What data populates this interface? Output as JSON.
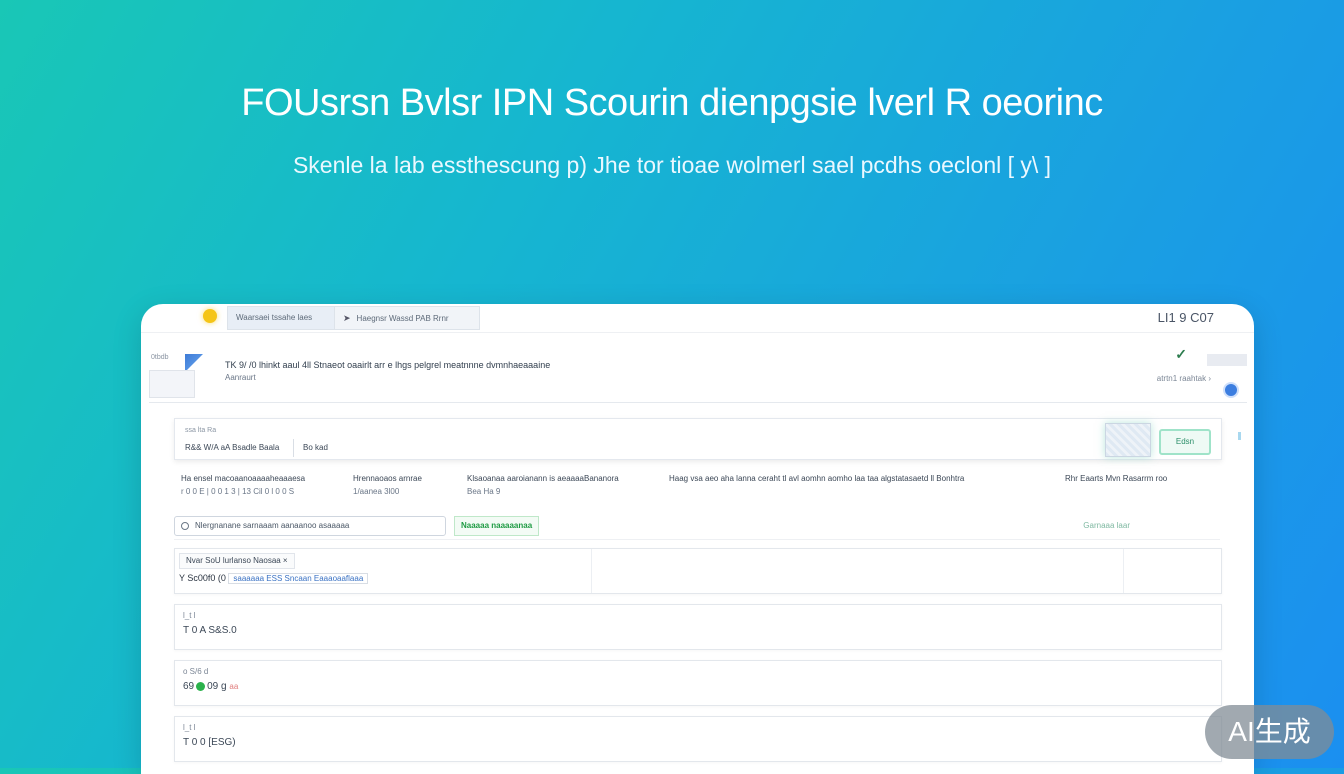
{
  "hero": {
    "title": "FOUsrsn Bvlsr IPN Scourin dienpgsie lverl R oeorinc",
    "subtitle": "Skenle la lab essthescung p) Jhe tor tioae wolmerl sael pcdhs oeclonl [ y\\ ]"
  },
  "window": {
    "tabs": [
      "Waarsaei tssahe laes",
      "Haegnsr Wassd PAB Rrnr"
    ],
    "clock": "LI1 9 C07",
    "header": {
      "line1": "TK 9/ /0 lhinkt aaul 4ll Stnaeot oaairlt arr e lhgs pelgrel meatnnne dvmnhaeaaaine",
      "line2": "Aanraurt",
      "logo_caption": "0tbdb",
      "right_text": "atrtn1 raahtak ›"
    },
    "filter": {
      "label": "ssa   lta   Ra",
      "value": "R&& W/A aA Bsadle Baala",
      "extra": "Bo kad",
      "button": "Edsn"
    },
    "info_columns": [
      {
        "top": "Ha ensel macoaanoaaaaheaaaesa",
        "bottom": "r 0 0 E | 0 0 1 3 | 13 Cil 0 l 0 0 S"
      },
      {
        "top": "Hrennaoaos arnrae",
        "bottom": "1/aanea 3l00"
      },
      {
        "top": "Klsaoanaa aaroianann is aeaaaaBananora",
        "bottom": "Bea Ha 9"
      },
      {
        "top": "Haag vsa aeo aha lanna ceraht tl avl aomhn aomho laa taa algstatasaetd ll Bonhtra",
        "bottom": ""
      },
      {
        "top": "Rhr Eaarts Mvn Rasarrm roo",
        "bottom": ""
      }
    ],
    "action_bar": {
      "search_text": "Nlergnanane   sarnaaam aanaanoo asaaaaa",
      "status": "Naaaaa naaaaanaa",
      "right_link": "Garnaaa  laar"
    },
    "rows": [
      {
        "tab": "Nvar SoU lurlanso Naosaa  ×",
        "main": "Y Sc00f0 (0",
        "main_blue": "saaaaaa   ESS  Sncaan  Eaaaoaaflaaa"
      },
      {
        "top": "l_t  l",
        "value": "T 0 A  S&S.0"
      },
      {
        "top": "o S/6  d",
        "value_prefix": "69",
        "value_suffix": "09 g",
        "value_red": "aa"
      },
      {
        "top": "l_t  l",
        "value": "T 0 0  [ESG)"
      }
    ]
  },
  "watermark": "AI生成",
  "colors": {
    "background_start": "#19c7b6",
    "background_end": "#1b8ff0",
    "status_green": "#1e9b43",
    "accent_blue": "#3c7ee0"
  }
}
